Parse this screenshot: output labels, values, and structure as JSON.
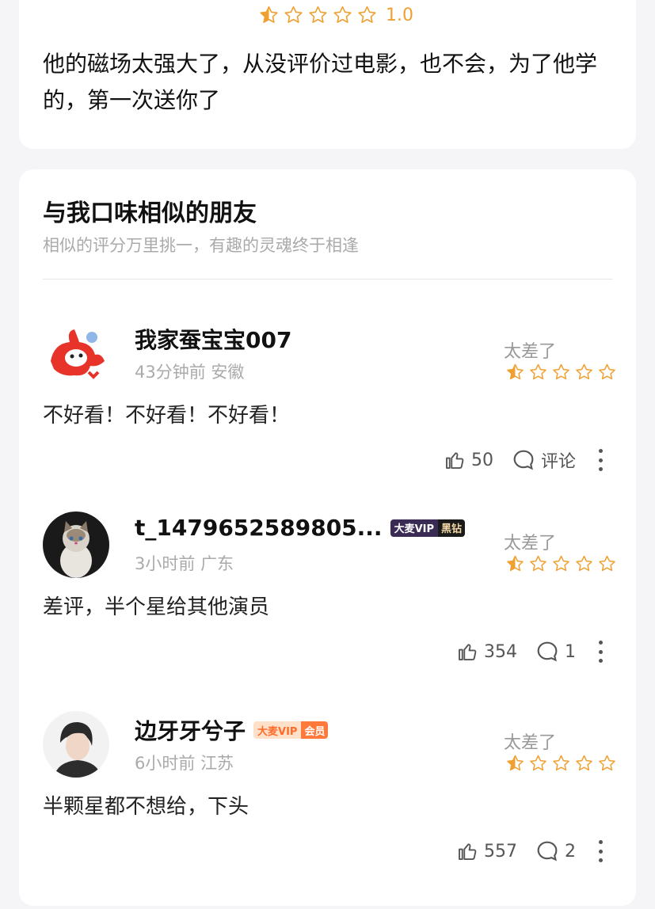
{
  "top_review": {
    "rating_stars": 0.5,
    "rating_value": "1.0",
    "text": "他的磁场太强大了，从没评价过电影，也不会，为了他学的，第一次送你了"
  },
  "friends_section": {
    "title": "与我口味相似的朋友",
    "subtitle": "相似的评分万里挑一，有趣的灵魂终于相逢"
  },
  "comments": [
    {
      "username": "我家蚕宝宝007",
      "badge": null,
      "time": "43分钟前",
      "location": "安徽",
      "verdict": "太差了",
      "stars": 0.5,
      "text": "不好看！不好看！不好看！",
      "likes": "50",
      "comment_label": "评论"
    },
    {
      "username": "t_1479652589805...",
      "badge": {
        "left": "大麦VIP",
        "right": "黑钻",
        "style": "black"
      },
      "time": "3小时前",
      "location": "广东",
      "verdict": "太差了",
      "stars": 0.5,
      "text": "差评，半个星给其他演员",
      "likes": "354",
      "comment_label": "1"
    },
    {
      "username": "边牙牙兮子",
      "badge": {
        "left": "大麦VIP",
        "right": "会员",
        "style": "member"
      },
      "time": "6小时前",
      "location": "江苏",
      "verdict": "太差了",
      "stars": 0.5,
      "text": "半颗星都不想给，下头",
      "likes": "557",
      "comment_label": "2"
    }
  ],
  "colors": {
    "star": "#f0a030",
    "accent_text": "#f0a030",
    "muted": "#aaaaaa"
  },
  "icons": [
    "star-half-icon",
    "star-empty-icon",
    "thumbs-up-icon",
    "comment-bubble-icon",
    "more-vertical-icon"
  ]
}
